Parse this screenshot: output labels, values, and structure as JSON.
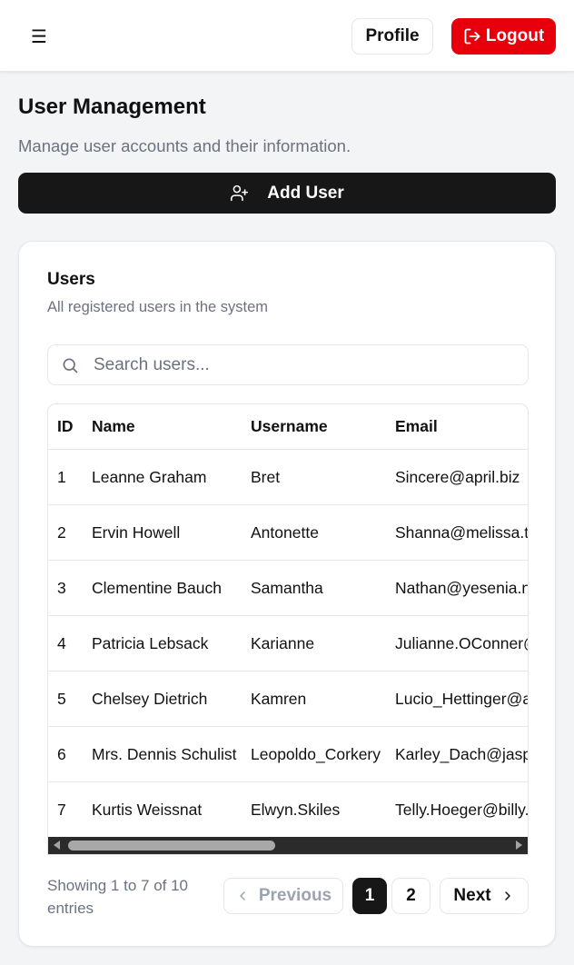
{
  "header": {
    "menu_icon": "hamburger-menu-icon",
    "profile_label": "Profile",
    "logout_label": "Logout",
    "logout_icon": "logout-icon",
    "logout_color": "#e7000b"
  },
  "page": {
    "title": "User Management",
    "subtitle": "Manage user accounts and their information.",
    "add_user_label": "Add User",
    "add_user_icon": "user-plus-icon"
  },
  "card": {
    "title": "Users",
    "description": "All registered users in the system",
    "search": {
      "placeholder": "Search users...",
      "value": "",
      "icon": "search-icon"
    }
  },
  "table": {
    "columns": [
      "ID",
      "Name",
      "Username",
      "Email"
    ],
    "rows": [
      {
        "id": "1",
        "name": "Leanne Graham",
        "username": "Bret",
        "email": "Sincere@april.biz"
      },
      {
        "id": "2",
        "name": "Ervin Howell",
        "username": "Antonette",
        "email": "Shanna@melissa.tv"
      },
      {
        "id": "3",
        "name": "Clementine Bauch",
        "username": "Samantha",
        "email": "Nathan@yesenia.net"
      },
      {
        "id": "4",
        "name": "Patricia Lebsack",
        "username": "Karianne",
        "email": "Julianne.OConner@kory.org"
      },
      {
        "id": "5",
        "name": "Chelsey Dietrich",
        "username": "Kamren",
        "email": "Lucio_Hettinger@annie.ca"
      },
      {
        "id": "6",
        "name": "Mrs. Dennis Schulist",
        "username": "Leopoldo_Corkery",
        "email": "Karley_Dach@jasper.info"
      },
      {
        "id": "7",
        "name": "Kurtis Weissnat",
        "username": "Elwyn.Skiles",
        "email": "Telly.Hoeger@billy.biz"
      }
    ]
  },
  "pagination": {
    "summary": "Showing 1 to 7 of 10 entries",
    "previous_label": "Previous",
    "next_label": "Next",
    "pages": [
      "1",
      "2"
    ],
    "current_page": "1"
  },
  "colors": {
    "primary_dark": "#171717",
    "background": "#f3f4f6",
    "muted_text": "#6b7280"
  }
}
